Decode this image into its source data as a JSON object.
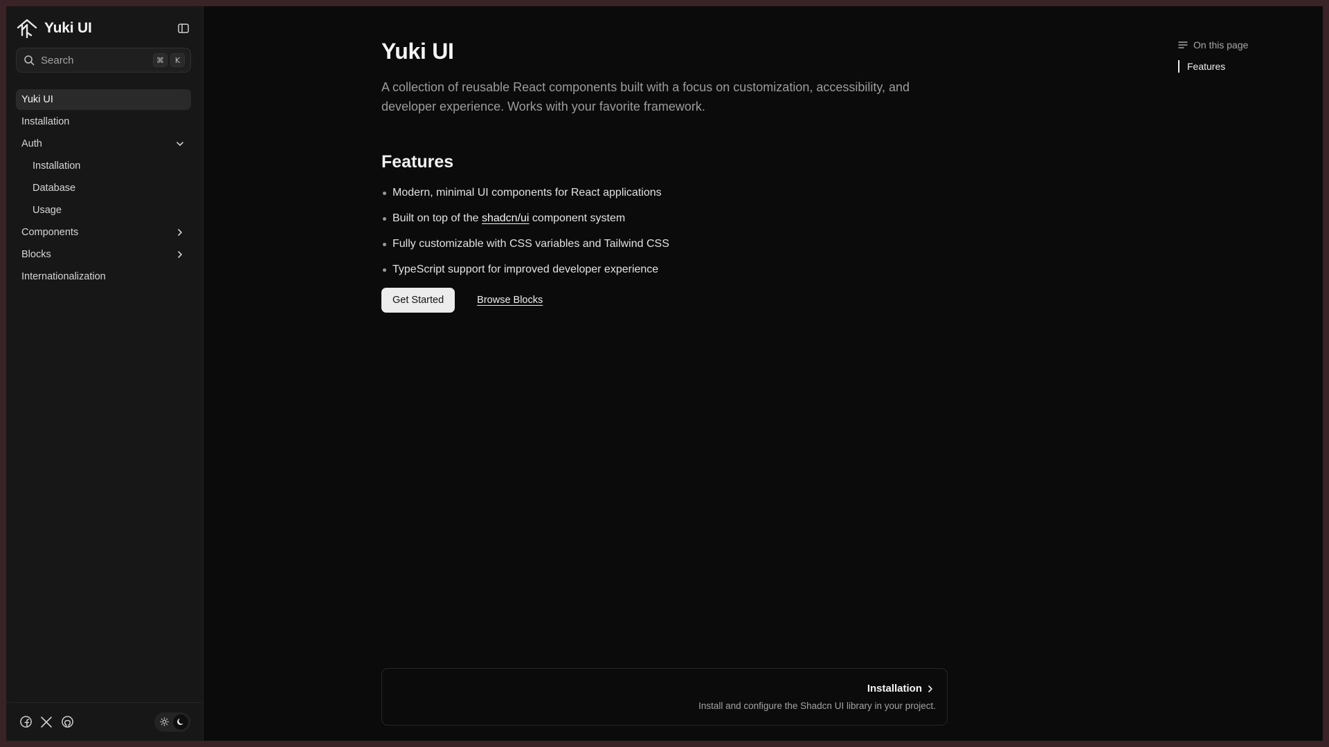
{
  "colors": {
    "window_bg": "#0b0b0b",
    "sidebar_bg": "#171717",
    "outer_frame": "#3a2326",
    "active_item_bg": "#2a2a2a",
    "primary_button_bg": "#ececec"
  },
  "sidebar": {
    "brand_name": "Yuki UI",
    "search": {
      "placeholder": "Search",
      "shortcut_keys": [
        "⌘",
        "K"
      ]
    },
    "items": [
      {
        "label": "Yuki UI",
        "active": true
      },
      {
        "label": "Installation"
      },
      {
        "label": "Auth",
        "expanded": true,
        "icon": "chevron-down-icon"
      },
      {
        "label": "Installation",
        "sub": true
      },
      {
        "label": "Database",
        "sub": true
      },
      {
        "label": "Usage",
        "sub": true
      },
      {
        "label": "Components",
        "icon": "chevron-right-icon"
      },
      {
        "label": "Blocks",
        "icon": "chevron-right-icon"
      },
      {
        "label": "Internationalization"
      }
    ],
    "footer": {
      "social_icons": [
        "facebook-icon",
        "x-icon",
        "github-icon"
      ],
      "theme": {
        "options": [
          "sun-icon",
          "moon-icon"
        ],
        "selected": "moon-icon"
      }
    }
  },
  "main": {
    "title": "Yuki UI",
    "description": "A collection of reusable React components built with a focus on customization, accessibility, and developer experience. Works with your favorite framework.",
    "features_heading": "Features",
    "features": [
      {
        "text": "Modern, minimal UI components for React applications"
      },
      {
        "before": "Built on top of the ",
        "link": "shadcn/ui",
        "after": " component system"
      },
      {
        "text": "Fully customizable with CSS variables and Tailwind CSS"
      },
      {
        "text": "TypeScript support for improved developer experience"
      }
    ],
    "primary_button": "Get Started",
    "secondary_link": "Browse Blocks",
    "next_card": {
      "title": "Installation",
      "description": "Install and configure the Shadcn UI library in your project."
    }
  },
  "toc": {
    "heading": "On this page",
    "items": [
      "Features"
    ]
  }
}
